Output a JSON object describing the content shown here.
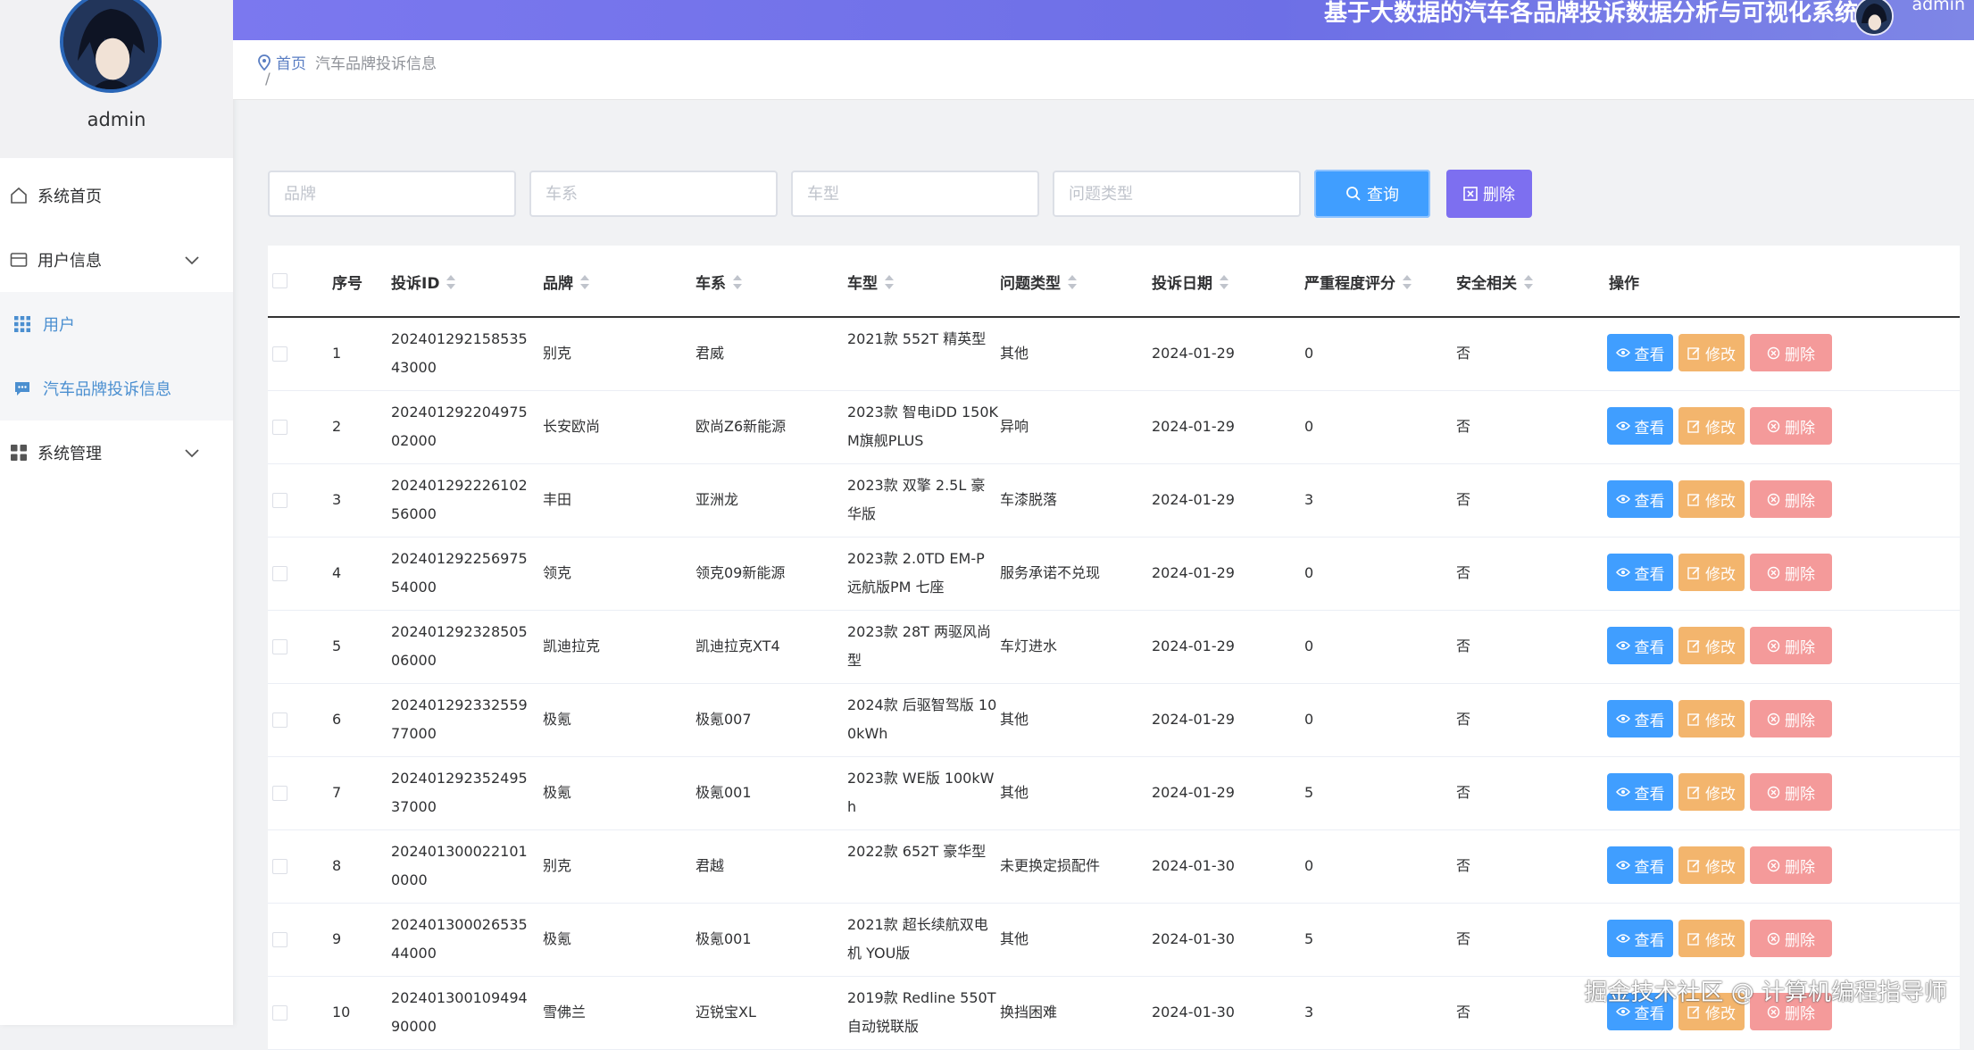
{
  "header": {
    "title": "基于大数据的汽车各品牌投诉数据分析与可视化系统",
    "user": "admin"
  },
  "profile": {
    "name": "admin"
  },
  "menu": [
    {
      "label": "系统首页",
      "icon": "home-icon"
    },
    {
      "label": "用户信息",
      "icon": "card-icon"
    },
    {
      "label": "用户",
      "icon": "grid-icon"
    },
    {
      "label": "汽车品牌投诉信息",
      "icon": "chat-icon"
    },
    {
      "label": "系统管理",
      "icon": "apps-icon"
    }
  ],
  "breadcrumb": {
    "home": "首页",
    "current": "汽车品牌投诉信息",
    "sep": "/"
  },
  "search": {
    "brand_placeholder": "品牌",
    "series_placeholder": "车系",
    "model_placeholder": "车型",
    "issue_placeholder": "问题类型",
    "query_label": "查询",
    "delete_label": "删除"
  },
  "table": {
    "columns": [
      "序号",
      "投诉ID",
      "品牌",
      "车系",
      "车型",
      "问题类型",
      "投诉日期",
      "严重程度评分",
      "安全相关",
      "操作"
    ],
    "actions": {
      "view": "查看",
      "edit": "修改",
      "delete": "删除"
    },
    "rows": [
      {
        "no": "1",
        "id": "20240129215853543000",
        "brand": "别克",
        "series": "君威",
        "model": "2021款 552T 精英型",
        "issue": "其他",
        "date": "2024-01-29",
        "score": "0",
        "safety": "否"
      },
      {
        "no": "2",
        "id": "20240129220497502000",
        "brand": "长安欧尚",
        "series": "欧尚Z6新能源",
        "model": "2023款 智电iDD 150KM旗舰PLUS",
        "issue": "异响",
        "date": "2024-01-29",
        "score": "0",
        "safety": "否"
      },
      {
        "no": "3",
        "id": "20240129222610256000",
        "brand": "丰田",
        "series": "亚洲龙",
        "model": "2023款 双擎 2.5L 豪华版",
        "issue": "车漆脱落",
        "date": "2024-01-29",
        "score": "3",
        "safety": "否"
      },
      {
        "no": "4",
        "id": "20240129225697554000",
        "brand": "领克",
        "series": "领克09新能源",
        "model": "2023款 2.0TD EM-P 远航版PM 七座",
        "issue": "服务承诺不兑现",
        "date": "2024-01-29",
        "score": "0",
        "safety": "否"
      },
      {
        "no": "5",
        "id": "20240129232850506000",
        "brand": "凯迪拉克",
        "series": "凯迪拉克XT4",
        "model": "2023款 28T 两驱风尚型",
        "issue": "车灯进水",
        "date": "2024-01-29",
        "score": "0",
        "safety": "否"
      },
      {
        "no": "6",
        "id": "20240129233255977000",
        "brand": "极氪",
        "series": "极氪007",
        "model": "2024款 后驱智驾版 100kWh",
        "issue": "其他",
        "date": "2024-01-29",
        "score": "0",
        "safety": "否"
      },
      {
        "no": "7",
        "id": "20240129235249537000",
        "brand": "极氪",
        "series": "极氪001",
        "model": "2023款 WE版 100kWh",
        "issue": "其他",
        "date": "2024-01-29",
        "score": "5",
        "safety": "否"
      },
      {
        "no": "8",
        "id": "2024013000221010000",
        "brand": "别克",
        "series": "君越",
        "model": "2022款 652T 豪华型",
        "issue": "未更换定损配件",
        "date": "2024-01-30",
        "score": "0",
        "safety": "否"
      },
      {
        "no": "9",
        "id": "20240130002653544000",
        "brand": "极氪",
        "series": "极氪001",
        "model": "2021款 超长续航双电机 YOU版",
        "issue": "其他",
        "date": "2024-01-30",
        "score": "5",
        "safety": "否"
      },
      {
        "no": "10",
        "id": "20240130010949490000",
        "brand": "雪佛兰",
        "series": "迈锐宝XL",
        "model": "2019款 Redline 550T 自动锐联版",
        "issue": "换挡困难",
        "date": "2024-01-30",
        "score": "3",
        "safety": "否"
      }
    ]
  },
  "watermark": "掘金技术社区 @ 计算机编程指导师"
}
